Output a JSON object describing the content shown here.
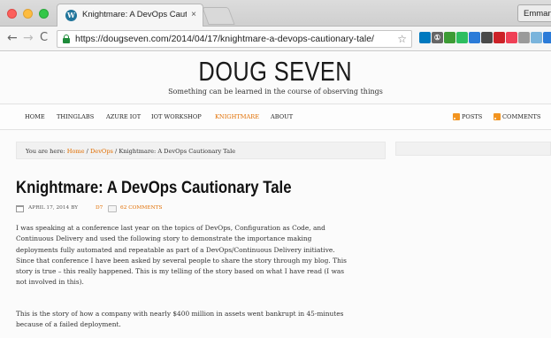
{
  "browser": {
    "tab_title": "Knightmare: A DevOps Caution",
    "tab_close_glyph": "×",
    "favicon_glyph": "W",
    "profile_name": "Emmanu",
    "back_glyph": "←",
    "forward_glyph": "→",
    "reload_glyph": "C",
    "url": "https://dougseven.com/2014/04/17/knightmare-a-devops-cautionary-tale/",
    "star_glyph": "☆",
    "extensions": [
      {
        "name": "trello-icon",
        "color": "#0079bf",
        "glyph": ""
      },
      {
        "name": "onepassword-icon",
        "color": "#666666",
        "glyph": "①"
      },
      {
        "name": "pin-icon",
        "color": "#3d9b35",
        "glyph": ""
      },
      {
        "name": "evernote-icon",
        "color": "#2dbe60",
        "glyph": ""
      },
      {
        "name": "flag-icon",
        "color": "#2b7bd8",
        "glyph": ""
      },
      {
        "name": "tag-icon",
        "color": "#4a4a4a",
        "glyph": ""
      },
      {
        "name": "lastpass-icon",
        "color": "#cc2127",
        "glyph": ""
      },
      {
        "name": "pocket-icon",
        "color": "#ef4056",
        "glyph": ""
      },
      {
        "name": "notes-icon",
        "color": "#9a9a9a",
        "glyph": ""
      },
      {
        "name": "ghostery-icon",
        "color": "#7ab4dc",
        "glyph": ""
      },
      {
        "name": "keep-icon",
        "color": "#2b7bd8",
        "glyph": ""
      }
    ]
  },
  "site": {
    "title": "DOUG SEVEN",
    "tagline": "Something can be learned in the course of observing things",
    "nav": {
      "home": "HOME",
      "thinglabs": "THINGLABS",
      "azure_iot": "AZURE IOT",
      "iot_workshop": "IOT WORKSHOP",
      "knightmare": "KNIGHTMARE",
      "about": "ABOUT"
    },
    "feeds": {
      "posts": "POSTS",
      "comments": "COMMENTS"
    }
  },
  "breadcrumb": {
    "prefix": "You are here: ",
    "home": "Home",
    "sep1": " / ",
    "devops": "DevOps",
    "sep2": " / ",
    "current": "Knightmare: A DevOps Cautionary Tale"
  },
  "post": {
    "title": "Knightmare: A DevOps Cautionary Tale",
    "date": "APRIL 17, 2014 BY",
    "author": "D7",
    "comments": "62 COMMENTS",
    "paragraph1": [
      "I was speaking at a conference last year on the topics of DevOps, Configuration as Code, and",
      "Continuous Delivery and used the following story to demonstrate the importance making",
      "deployments fully automated and repeatable as part of a DevOps/Continuous Delivery initiative.",
      "Since that conference I have been asked by several people to share the story through my blog. This",
      "story is true – this really happened. This is my telling of the story based on what I have read (I was",
      "not involved in this)."
    ],
    "paragraph2": [
      "This is the story of how a company with nearly $400 million in assets went bankrupt in 45-minutes",
      "because of a failed deployment."
    ]
  }
}
